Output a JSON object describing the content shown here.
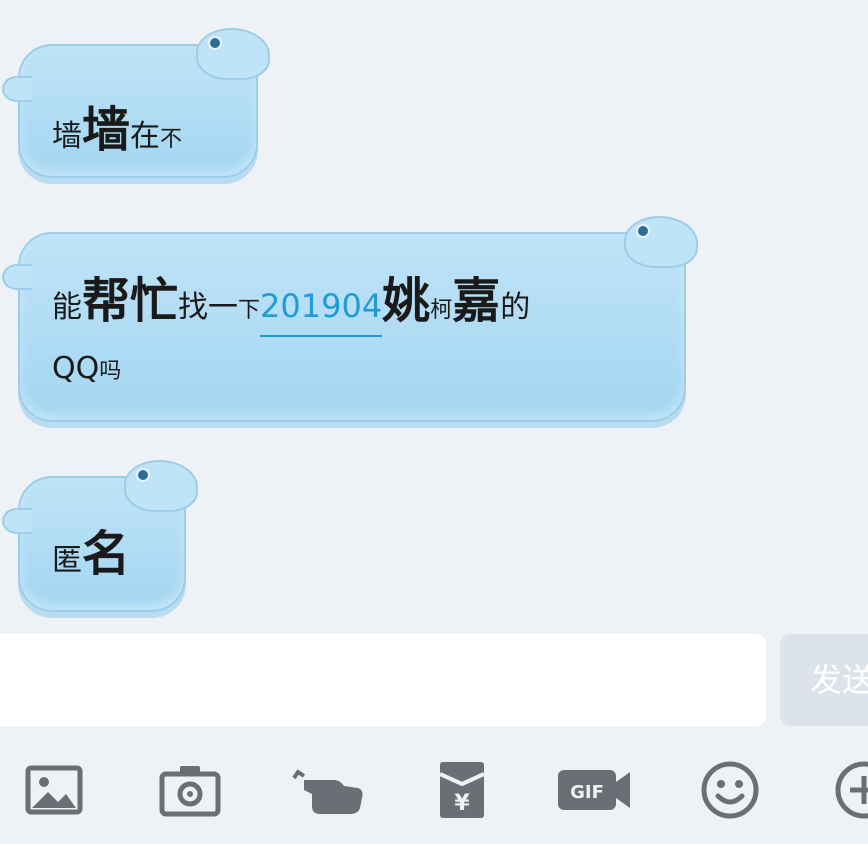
{
  "messages": [
    {
      "parts": [
        {
          "text": "墙",
          "style": "sm"
        },
        {
          "text": "墙",
          "style": "lg"
        },
        {
          "text": "在",
          "style": "sm"
        },
        {
          "text": "不",
          "style": "xs"
        }
      ]
    },
    {
      "parts": [
        {
          "text": "能",
          "style": "sm"
        },
        {
          "text": "帮",
          "style": "lg"
        },
        {
          "text": "忙",
          "style": "lg"
        },
        {
          "text": "找",
          "style": "sm"
        },
        {
          "text": "一",
          "style": "sm"
        },
        {
          "text": "下",
          "style": "xs"
        },
        {
          "text": "201904",
          "style": "link"
        },
        {
          "text": "姚",
          "style": "lg"
        },
        {
          "text": "柯",
          "style": "xs"
        },
        {
          "text": "嘉",
          "style": "lg"
        },
        {
          "text": "的",
          "style": "sm"
        }
      ],
      "line2": [
        {
          "text": "QQ",
          "style": "sm"
        },
        {
          "text": "吗",
          "style": "xs"
        }
      ]
    },
    {
      "parts": [
        {
          "text": "匿",
          "style": "sm"
        },
        {
          "text": "名",
          "style": "lg"
        }
      ]
    }
  ],
  "input": {
    "value": ""
  },
  "send_button": {
    "label": "发送"
  },
  "toolbar": {
    "icons": [
      "image-icon",
      "camera-icon",
      "poke-icon",
      "red-packet-icon",
      "gif-icon",
      "emoji-icon",
      "plus-icon"
    ]
  },
  "colors": {
    "background": "#eef1f6",
    "bubble": "#a3d6f2",
    "link": "#1f9bd6",
    "icon": "#6b6f75"
  }
}
